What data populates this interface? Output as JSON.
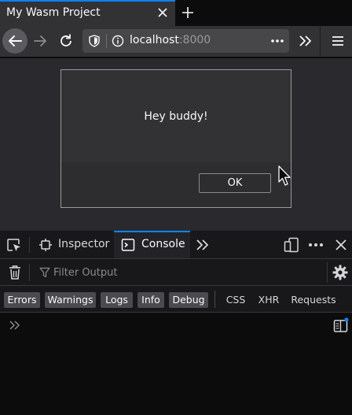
{
  "browser": {
    "tab": {
      "title": "My Wasm Project"
    },
    "address_bar": {
      "host": "localhost",
      "port": ":8000"
    }
  },
  "page": {
    "dialog": {
      "message": "Hey buddy!",
      "ok_label": "OK"
    }
  },
  "devtools": {
    "tabs": [
      {
        "label": "Inspector",
        "active": false
      },
      {
        "label": "Console",
        "active": true
      }
    ],
    "filter": {
      "placeholder": "Filter Output",
      "value": ""
    },
    "categories": [
      {
        "label": "Errors",
        "enabled": true
      },
      {
        "label": "Warnings",
        "enabled": true
      },
      {
        "label": "Logs",
        "enabled": true
      },
      {
        "label": "Info",
        "enabled": true
      },
      {
        "label": "Debug",
        "enabled": true
      },
      {
        "label": "CSS",
        "enabled": false
      },
      {
        "label": "XHR",
        "enabled": false
      },
      {
        "label": "Requests",
        "enabled": false
      }
    ],
    "console_input": {
      "value": ""
    }
  },
  "colors": {
    "accent": "#0a84ff",
    "toolbar": "#323234",
    "page_background": "#2a2a2e",
    "devtools_background": "#18181a",
    "console_background": "#0c0c0d"
  },
  "icons": [
    "close-icon",
    "plus-icon",
    "back-arrow-icon",
    "forward-arrow-icon",
    "reload-icon",
    "shield-icon",
    "info-icon",
    "more-dots-icon",
    "overflow-chevron-icon",
    "hamburger-menu-icon",
    "element-picker-icon",
    "inspector-icon",
    "console-icon",
    "responsive-design-icon",
    "trash-icon",
    "filter-icon",
    "gear-icon",
    "console-prompt-icon",
    "split-console-icon",
    "mouse-cursor-icon"
  ]
}
